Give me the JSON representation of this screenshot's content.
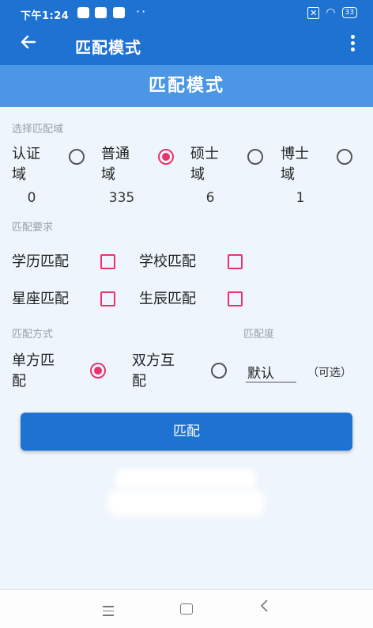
{
  "status_bar": {
    "time": "下午1:24",
    "dots": "··",
    "battery": "33"
  },
  "toolbar": {
    "title": "匹配模式"
  },
  "banner": {
    "title": "匹配模式"
  },
  "domain_section": {
    "label": "选择匹配域",
    "options": [
      {
        "line1": "认证",
        "line2": "域",
        "count": "0",
        "selected": false
      },
      {
        "line1": "普通",
        "line2": "域",
        "count": "335",
        "selected": true
      },
      {
        "line1": "硕士",
        "line2": "域",
        "count": "6",
        "selected": false
      },
      {
        "line1": "博士",
        "line2": "域",
        "count": "1",
        "selected": false
      }
    ]
  },
  "requirements": {
    "label": "匹配要求",
    "items": [
      {
        "label": "学历匹配",
        "checked": false
      },
      {
        "label": "学校匹配",
        "checked": false
      },
      {
        "label": "星座匹配",
        "checked": false
      },
      {
        "label": "生辰匹配",
        "checked": false
      }
    ]
  },
  "method": {
    "label": "匹配方式",
    "options": [
      {
        "line1": "单方匹",
        "line2": "配",
        "selected": true
      },
      {
        "line1": "双方互",
        "line2": "配",
        "selected": false
      }
    ]
  },
  "degree": {
    "label": "匹配度",
    "value": "默认",
    "optional": "（可选）"
  },
  "match_button": {
    "label": "匹配"
  },
  "colors": {
    "primary": "#1e73d2",
    "banner": "#4b97e6",
    "accent": "#e8336c",
    "background": "#eef5fc"
  },
  "icons": {
    "back": "arrow-left-icon",
    "more": "more-vert-icon"
  }
}
